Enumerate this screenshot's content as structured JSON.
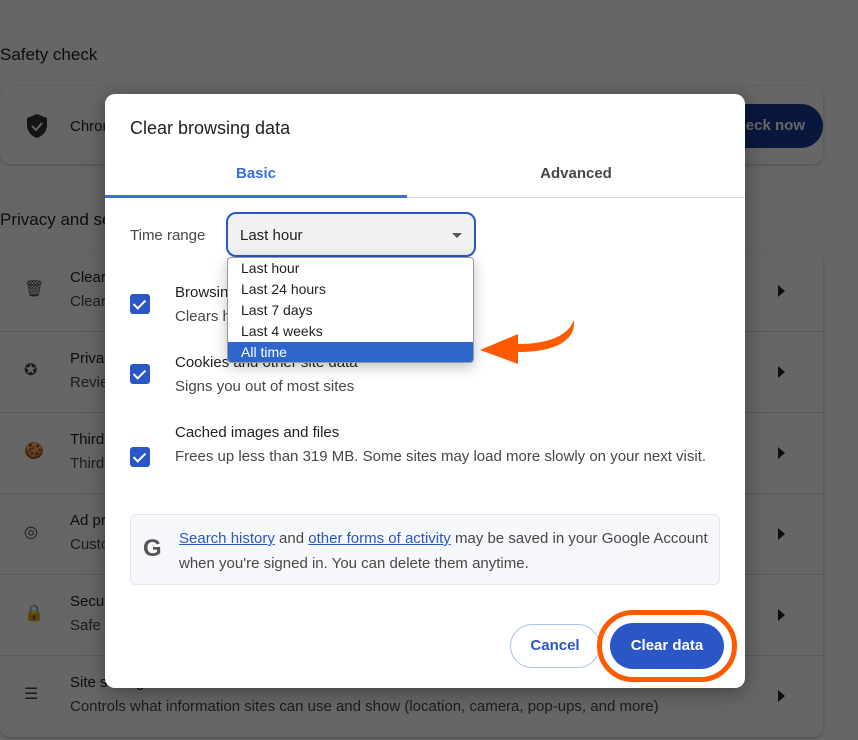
{
  "background": {
    "safety_check": {
      "title": "Safety check",
      "text": "Chrome",
      "button": "Check now"
    },
    "privacy": {
      "title": "Privacy and security",
      "rows": [
        {
          "icon": "trash-icon",
          "title": "Clear browsing data",
          "subtitle": "Clear history, cookies, cache, and more"
        },
        {
          "icon": "compass-icon",
          "title": "Privacy Guide",
          "subtitle": "Review key privacy and security controls"
        },
        {
          "icon": "cookie-icon",
          "title": "Third-party cookies",
          "subtitle": "Third-party cookies are blocked"
        },
        {
          "icon": "ad-privacy-icon",
          "title": "Ad privacy",
          "subtitle": "Customize the info used by sites to show you ads"
        },
        {
          "icon": "lock-icon",
          "title": "Security",
          "subtitle": "Safe Browsing (protection from dangerous sites) and other security settings"
        },
        {
          "icon": "tune-icon",
          "title": "Site settings",
          "subtitle": "Controls what information sites can use and show (location, camera, pop-ups, and more)"
        }
      ]
    }
  },
  "dialog": {
    "title": "Clear browsing data",
    "tabs": [
      {
        "label": "Basic",
        "active": true
      },
      {
        "label": "Advanced",
        "active": false
      }
    ],
    "time_range": {
      "label": "Time range",
      "value": "Last hour",
      "options": [
        "Last hour",
        "Last 24 hours",
        "Last 7 days",
        "Last 4 weeks",
        "All time"
      ],
      "highlighted": "All time"
    },
    "items": [
      {
        "title": "Browsing history",
        "desc": "Clears history from all synced devices",
        "checked": true
      },
      {
        "title": "Cookies and other site data",
        "desc": "Signs you out of most sites",
        "checked": true
      },
      {
        "title": "Cached images and files",
        "desc": "Frees up less than 319 MB. Some sites may load more slowly on your next visit.",
        "checked": true
      }
    ],
    "info": {
      "link1": "Search history",
      "mid": " and ",
      "link2": "other forms of activity",
      "rest": " may be saved in your Google Account when you're signed in. You can delete them anytime."
    },
    "cancel": "Cancel",
    "clear": "Clear data"
  },
  "colors": {
    "accent": "#2a56c6",
    "annotation": "#ff5a00"
  }
}
